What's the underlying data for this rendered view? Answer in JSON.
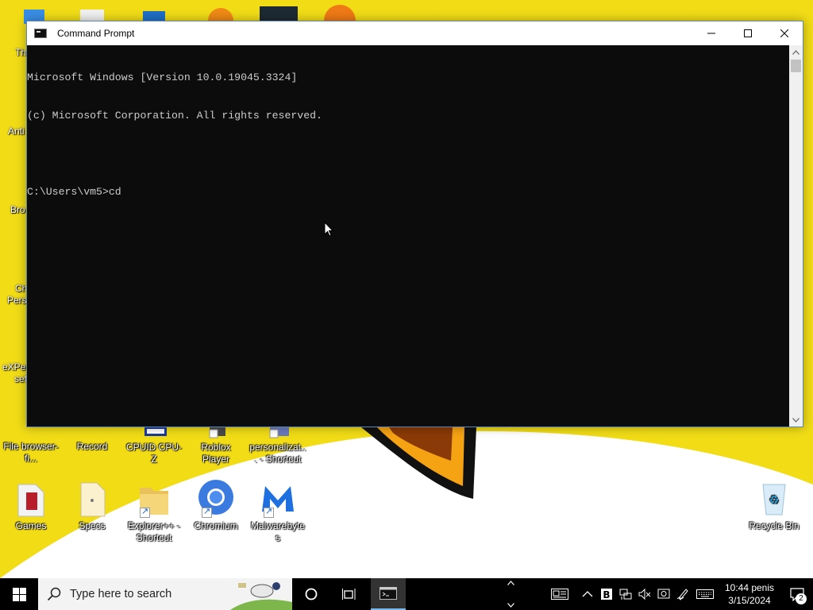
{
  "window": {
    "title": "Command Prompt",
    "console_lines": [
      "Microsoft Windows [Version 10.0.19045.3324]",
      "(c) Microsoft Corporation. All rights reserved.",
      "",
      "C:\\Users\\vm5>cd"
    ]
  },
  "desktop": {
    "partial_labels": {
      "th": "Th",
      "anti": "Anti",
      "bro": "Bro",
      "ch": "Ch",
      "pers": "Pers",
      "experi": "eXPer",
      "set": "set"
    },
    "icons": {
      "file_browser": "File browser-fi...",
      "record": "Record",
      "cpuid": "CPUID CPU-Z",
      "roblox": "Roblox Player",
      "personalization": "personalizat... - Shortcut",
      "games": "Games",
      "specs": "Specs",
      "explorer_pp": "Explorer++ - Shortcut",
      "chromium": "Chromium",
      "malwarebytes": "Malwarebytes",
      "recycle_bin": "Recycle Bin"
    }
  },
  "taskbar": {
    "search_placeholder": "Type here to search",
    "clock_time": "10:44 penis",
    "clock_date": "3/15/2024",
    "notification_count": "2"
  },
  "colors": {
    "wallpaper": "#f1dc16",
    "console_bg": "#0c0c0c",
    "console_text": "#cccccc",
    "taskbar_bg": "#000000",
    "accent": "#76b9ed"
  }
}
